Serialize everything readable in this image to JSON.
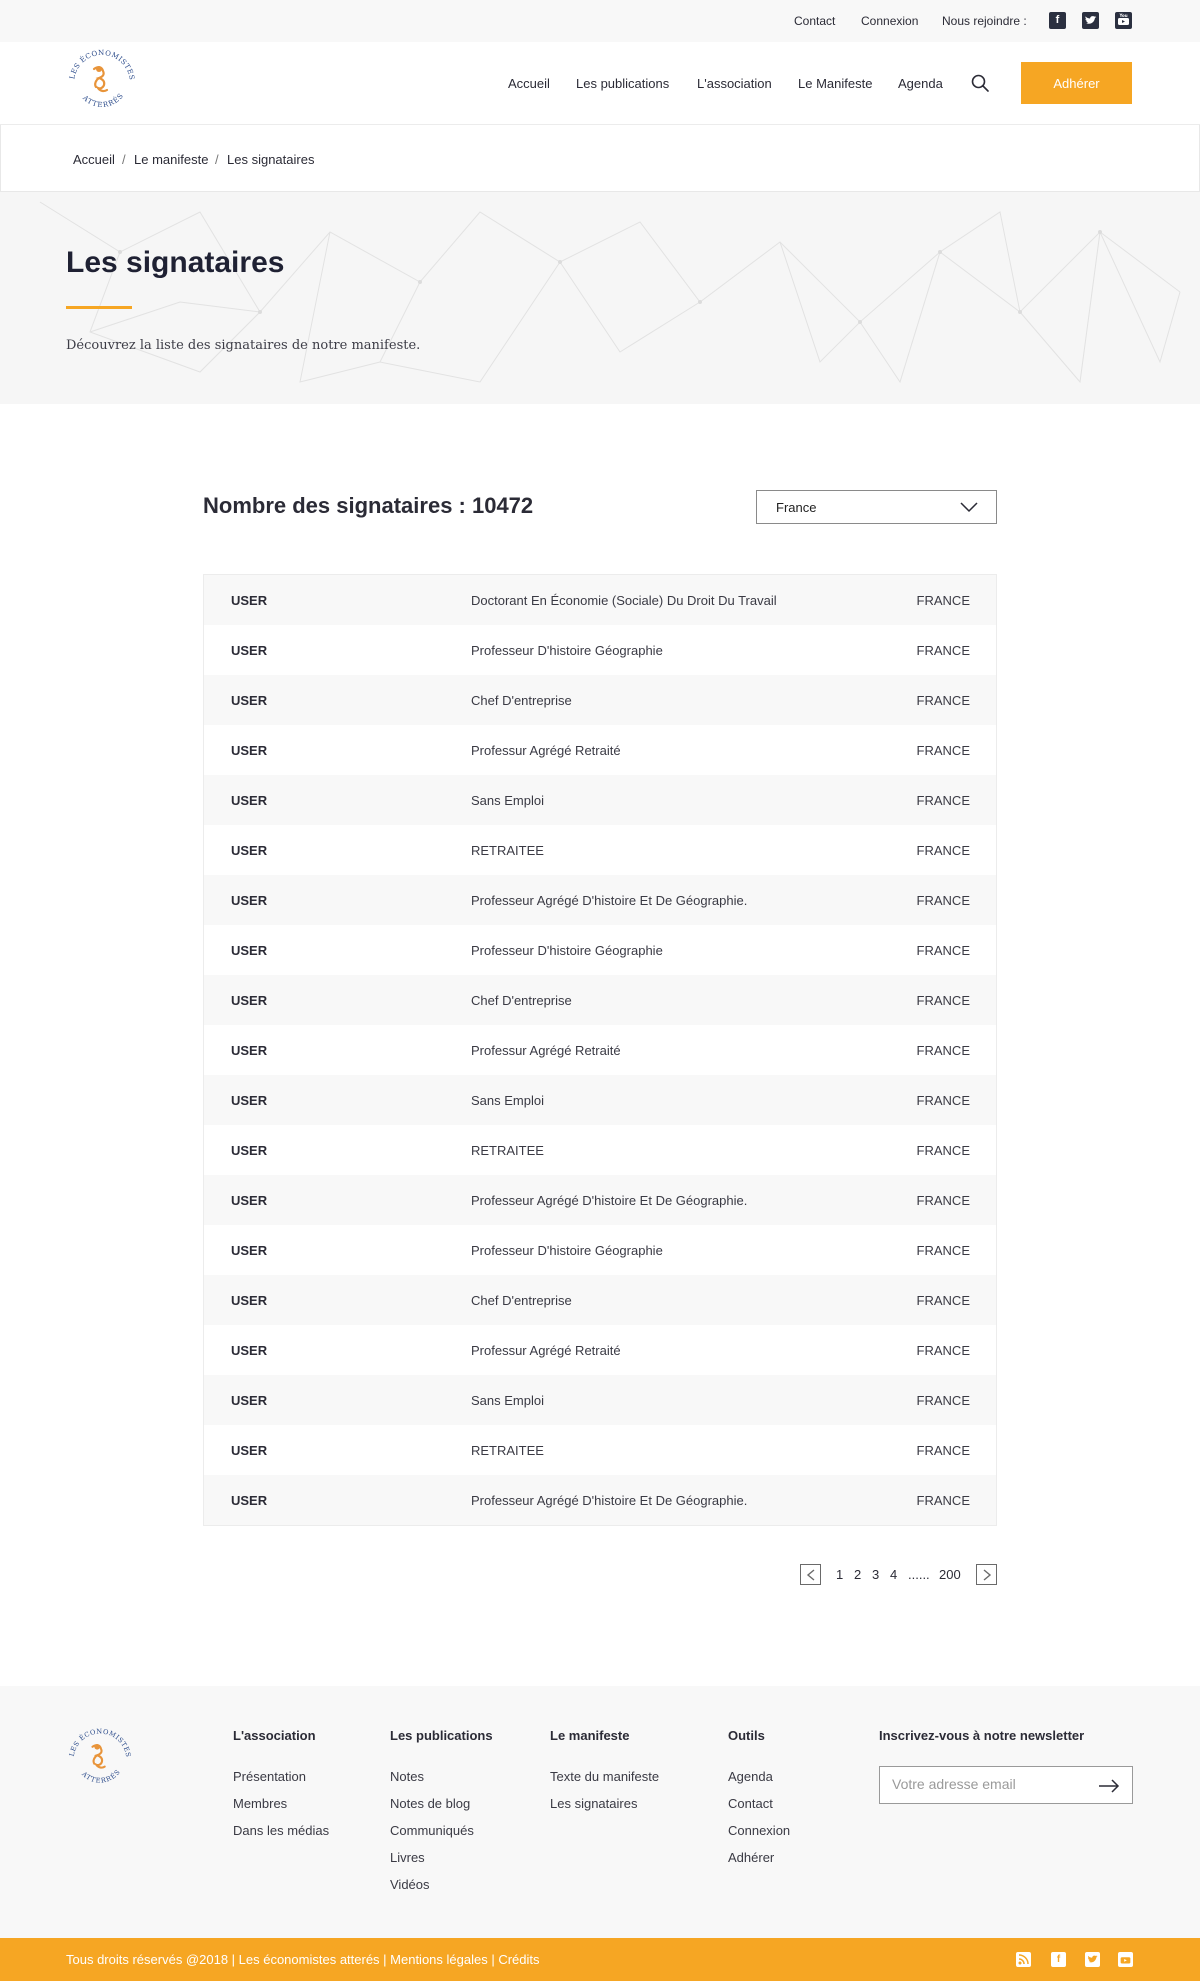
{
  "topbar": {
    "contact": "Contact",
    "login": "Connexion",
    "join_us": "Nous rejoindre :",
    "social": [
      "facebook-icon",
      "twitter-icon",
      "youtube-icon"
    ]
  },
  "header": {
    "logo_text": "LES ÉCONOMISTES ATTERRÉS",
    "nav": [
      "Accueil",
      "Les publications",
      "L'association",
      "Le Manifeste",
      "Agenda"
    ],
    "join_button": "Adhérer"
  },
  "breadcrumb": [
    "Accueil",
    "/",
    "Le manifeste",
    "/",
    "Les signataires"
  ],
  "hero": {
    "title": "Les signataires",
    "description": "Découvrez la liste des signataires de notre manifeste."
  },
  "signatories": {
    "count_label": "Nombre des signataires : 10472",
    "country_filter": "France",
    "rows": [
      {
        "name": "USER",
        "title": "Doctorant En Économie (Sociale) Du Droit Du Travail",
        "country": "FRANCE"
      },
      {
        "name": "USER",
        "title": "Professeur D'histoire Géographie",
        "country": "FRANCE"
      },
      {
        "name": "USER",
        "title": "Chef D'entreprise",
        "country": "FRANCE"
      },
      {
        "name": "USER",
        "title": "Professur Agrégé Retraité",
        "country": "FRANCE"
      },
      {
        "name": "USER",
        "title": "Sans Emploi",
        "country": "FRANCE"
      },
      {
        "name": "USER",
        "title": "RETRAITEE",
        "country": "FRANCE"
      },
      {
        "name": "USER",
        "title": "Professeur Agrégé D'histoire Et De Géographie.",
        "country": "FRANCE"
      },
      {
        "name": "USER",
        "title": "Professeur D'histoire Géographie",
        "country": "FRANCE"
      },
      {
        "name": "USER",
        "title": "Chef D'entreprise",
        "country": "FRANCE"
      },
      {
        "name": "USER",
        "title": "Professur Agrégé Retraité",
        "country": "FRANCE"
      },
      {
        "name": "USER",
        "title": "Sans Emploi",
        "country": "FRANCE"
      },
      {
        "name": "USER",
        "title": "RETRAITEE",
        "country": "FRANCE"
      },
      {
        "name": "USER",
        "title": "Professeur Agrégé D'histoire Et De Géographie.",
        "country": "FRANCE"
      },
      {
        "name": "USER",
        "title": "Professeur D'histoire Géographie",
        "country": "FRANCE"
      },
      {
        "name": "USER",
        "title": "Chef D'entreprise",
        "country": "FRANCE"
      },
      {
        "name": "USER",
        "title": "Professur Agrégé Retraité",
        "country": "FRANCE"
      },
      {
        "name": "USER",
        "title": "Sans Emploi",
        "country": "FRANCE"
      },
      {
        "name": "USER",
        "title": "RETRAITEE",
        "country": "FRANCE"
      },
      {
        "name": "USER",
        "title": "Professeur Agrégé D'histoire Et De Géographie.",
        "country": "FRANCE"
      }
    ]
  },
  "pagination": {
    "pages": [
      "1",
      "2",
      "3",
      "4"
    ],
    "ellipsis": "......",
    "last": "200"
  },
  "footer": {
    "logo_text": "LES ÉCONOMISTES ATTERRÉS",
    "columns": [
      {
        "title": "L'association",
        "links": [
          "Présentation",
          "Membres",
          "Dans les médias"
        ]
      },
      {
        "title": "Les publications",
        "links": [
          "Notes",
          "Notes de blog",
          "Communiqués",
          "Livres",
          "Vidéos"
        ]
      },
      {
        "title": "Le manifeste",
        "links": [
          "Texte du manifeste",
          "Les signataires"
        ]
      },
      {
        "title": "Outils",
        "links": [
          "Agenda",
          "Contact",
          "Connexion",
          "Adhérer"
        ]
      }
    ],
    "newsletter_title": "Inscrivez-vous à notre newsletter",
    "newsletter_placeholder": "Votre adresse email",
    "copyright": "Tous droits réservés @2018 | Les économistes atterés | Mentions légales | Crédits",
    "social": [
      "rss-icon",
      "facebook-icon",
      "twitter-icon",
      "youtube-icon"
    ]
  },
  "colors": {
    "accent": "#f6a623",
    "text": "#2b2b36",
    "social_dark": "#2b3040"
  }
}
